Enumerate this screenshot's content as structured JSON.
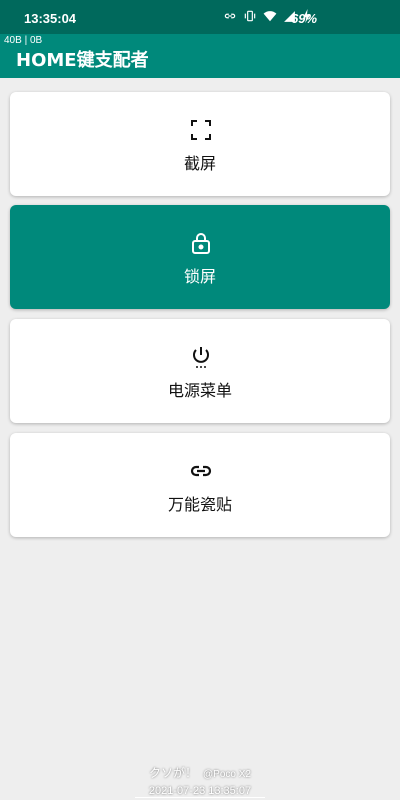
{
  "status_bar": {
    "time": "13:35:04",
    "battery": "69%",
    "icons": [
      "link-icon",
      "vibrate-icon",
      "wifi-icon",
      "signal-icon",
      "charging-icon"
    ]
  },
  "app_bar": {
    "net_speed": "40B | 0B",
    "title": "HOME键支配者",
    "color": "#00897b"
  },
  "cards": [
    {
      "label": "截屏",
      "icon": "screenshot-icon",
      "active": false
    },
    {
      "label": "锁屏",
      "icon": "lock-icon",
      "active": true
    },
    {
      "label": "电源菜单",
      "icon": "power-icon",
      "active": false
    },
    {
      "label": "万能瓷贴",
      "icon": "link-icon",
      "active": false
    }
  ],
  "watermark": {
    "line1": "クソが！",
    "brand": "@Poco X2",
    "line2": "2021-07-23 13:35:07"
  }
}
